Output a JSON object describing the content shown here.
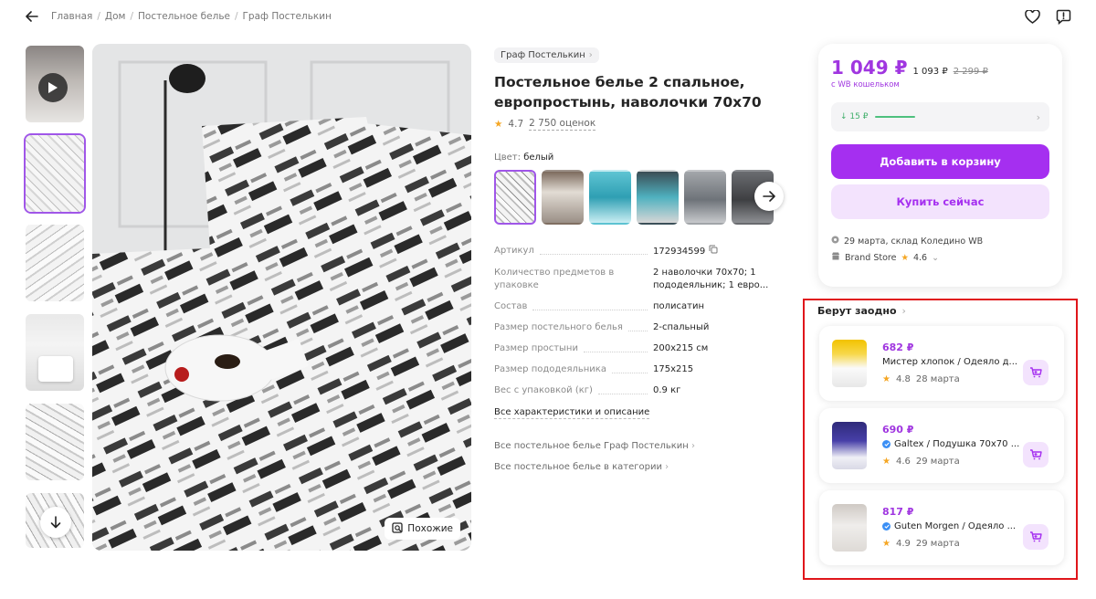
{
  "breadcrumbs": [
    "Главная",
    "Дом",
    "Постельное белье",
    "Граф Постелькин"
  ],
  "product": {
    "brand": "Граф Постелькин",
    "title": "Постельное белье 2 спальное, европростынь, наволочки 70х70",
    "rating": "4.7",
    "reviews": "2 750 оценок",
    "color_label": "Цвет:",
    "color_value": "белый",
    "similar_label": "Похожие"
  },
  "specs": [
    {
      "key": "Артикул",
      "value": "172934599"
    },
    {
      "key": "Количество предметов в упаковке",
      "value": "2 наволочки 70х70; 1 пододеяльник; 1 евро..."
    },
    {
      "key": "Состав",
      "value": "полисатин"
    },
    {
      "key": "Размер постельного белья",
      "value": "2-спальный"
    },
    {
      "key": "Размер простыни",
      "value": "200х215 см"
    },
    {
      "key": "Размер пододеяльника",
      "value": "175х215"
    },
    {
      "key": "Вес с упаковкой (кг)",
      "value": "0.9 кг"
    }
  ],
  "all_specs_link": "Все характеристики и описание",
  "links": [
    "Все постельное белье Граф Постелькин",
    "Все постельное белье в категории"
  ],
  "buybox": {
    "price": "1 049 ₽",
    "price_regular": "1 093 ₽",
    "price_old": "2 299 ₽",
    "wallet_note": "с WB кошельком",
    "cashback": "↓ 15 ₽",
    "add_to_cart": "Добавить в корзину",
    "buy_now": "Купить сейчас",
    "delivery": "29 марта, склад Коледино WB",
    "store": "Brand Store",
    "store_rating": "4.6"
  },
  "together": {
    "title": "Берут заодно",
    "items": [
      {
        "price": "682 ₽",
        "name": "Мистер хлопок / Одеяло д...",
        "verified": false,
        "rating": "4.8",
        "date": "28 марта"
      },
      {
        "price": "690 ₽",
        "name": "Galtex / Подушка 70х70 ...",
        "verified": true,
        "rating": "4.6",
        "date": "29 марта"
      },
      {
        "price": "817 ₽",
        "name": "Guten Morgen / Одеяло ...",
        "verified": true,
        "rating": "4.9",
        "date": "29 марта"
      }
    ]
  },
  "colors": {
    "accent": "#a52ff0",
    "price": "#a036e0",
    "highlight_border": "#e0161b",
    "star": "#f5a623"
  }
}
